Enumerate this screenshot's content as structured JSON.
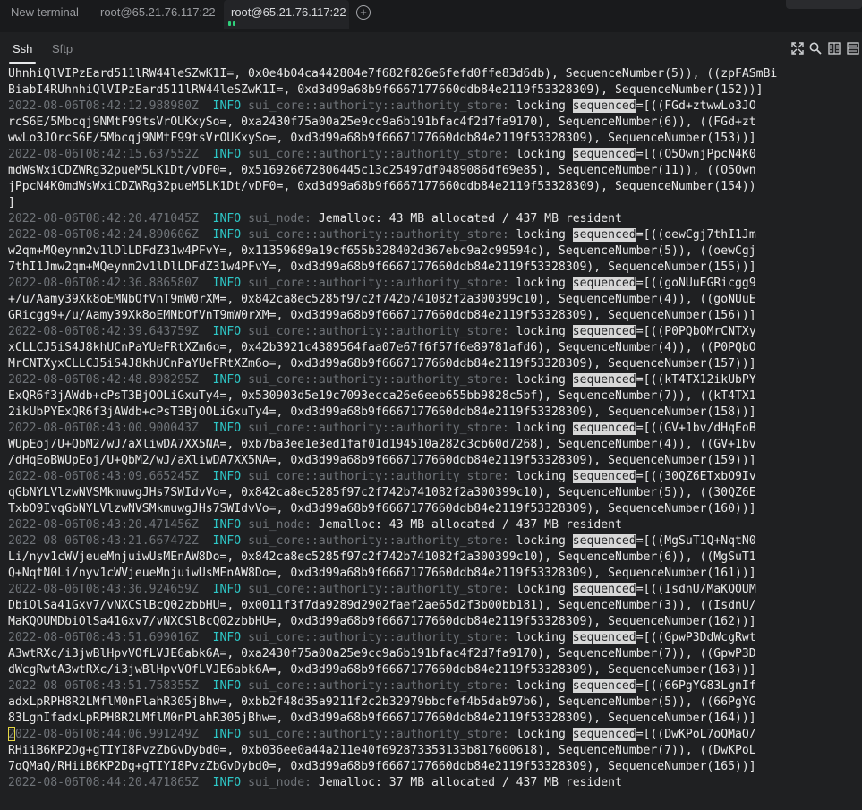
{
  "tabs": [
    {
      "label": "New terminal",
      "active": false
    },
    {
      "label": "root@65.21.76.117:22",
      "active": false
    },
    {
      "label": "root@65.21.76.117:22",
      "active": true
    }
  ],
  "subtabs": [
    {
      "label": "Ssh",
      "active": true
    },
    {
      "label": "Sftp",
      "active": false
    }
  ],
  "toolbar_icons": [
    "fullscreen-icon",
    "search-icon",
    "split-horizontal-icon",
    "split-vertical-icon"
  ],
  "colors": {
    "background": "#1f2022",
    "timestamp": "#6f7378",
    "info": "#2ec8c8",
    "text": "#e9e9e9",
    "highlight": "#d7d7d7",
    "cursor": "#e5d743",
    "status_dot": "#2fd07b"
  },
  "search_highlight": "sequenced",
  "terminal_lines": [
    {
      "text": "UhnhiQlVIPzEard511lRW44leSZwK1I=, 0x0e4b04ca442804e7f682f826e6fefd0ffe83d6db), SequenceNumber(5)), ((zpFASmBi"
    },
    {
      "text": "BiabI4RUhnhiQlVIPzEard511lRW44leSZwK1I=, 0xd3d99a68b9f6667177660ddb84e2119f53328309), SequenceNumber(152))]"
    },
    {
      "ts": "2022-08-06T08:42:12.988980Z",
      "level": "INFO",
      "module": "sui_core::authority::authority_store:",
      "msg": "locking",
      "hl": "sequenced",
      "rest": "=[((FGd+ztwwLo3JO"
    },
    {
      "text": "rcS6E/5Mbcqj9NMtF99tsVrOUKxySo=, 0xa2430f75a00a25e9cc9a6b191bfac4f2d7fa9170), SequenceNumber(6)), ((FGd+zt"
    },
    {
      "text": "wwLo3JOrcS6E/5Mbcqj9NMtF99tsVrOUKxySo=, 0xd3d99a68b9f6667177660ddb84e2119f53328309), SequenceNumber(153))]"
    },
    {
      "ts": "2022-08-06T08:42:15.637552Z",
      "level": "INFO",
      "module": "sui_core::authority::authority_store:",
      "msg": "locking",
      "hl": "sequenced",
      "rest": "=[((O5OwnjPpcN4K0"
    },
    {
      "text": "mdWsWxiCDZWRg32pueM5LK1Dt/vDF0=, 0x516926672806445c13c25497df0489086df69e85), SequenceNumber(11)), ((O5Own"
    },
    {
      "text": "jPpcN4K0mdWsWxiCDZWRg32pueM5LK1Dt/vDF0=, 0xd3d99a68b9f6667177660ddb84e2119f53328309), SequenceNumber(154))"
    },
    {
      "text": "]"
    },
    {
      "ts": "2022-08-06T08:42:20.471045Z",
      "level": "INFO",
      "module": "sui_node:",
      "msg": "Jemalloc: 43 MB allocated / 437 MB resident"
    },
    {
      "ts": "2022-08-06T08:42:24.890606Z",
      "level": "INFO",
      "module": "sui_core::authority::authority_store:",
      "msg": "locking",
      "hl": "sequenced",
      "rest": "=[((oewCgj7thI1Jm"
    },
    {
      "text": "w2qm+MQeynm2v1lDlLDFdZ31w4PFvY=, 0x11359689a19cf655b328402d367ebc9a2c99594c), SequenceNumber(5)), ((oewCgj"
    },
    {
      "text": "7thI1Jmw2qm+MQeynm2v1lDlLDFdZ31w4PFvY=, 0xd3d99a68b9f6667177660ddb84e2119f53328309), SequenceNumber(155))]"
    },
    {
      "ts": "2022-08-06T08:42:36.886580Z",
      "level": "INFO",
      "module": "sui_core::authority::authority_store:",
      "msg": "locking",
      "hl": "sequenced",
      "rest": "=[((goNUuEGRicgg9"
    },
    {
      "text": "+/u/Aamy39Xk8oEMNbOfVnT9mW0rXM=, 0x842ca8ec5285f97c2f742b741082f2a300399c10), SequenceNumber(4)), ((goNUuE"
    },
    {
      "text": "GRicgg9+/u/Aamy39Xk8oEMNbOfVnT9mW0rXM=, 0xd3d99a68b9f6667177660ddb84e2119f53328309), SequenceNumber(156))]"
    },
    {
      "ts": "2022-08-06T08:42:39.643759Z",
      "level": "INFO",
      "module": "sui_core::authority::authority_store:",
      "msg": "locking",
      "hl": "sequenced",
      "rest": "=[((P0PQbOMrCNTXy"
    },
    {
      "text": "xCLLCJ5iS4J8khUCnPaYUeFRtXZm6o=, 0x42b3921c4389564faa07e67f6f57f6e89781afd6), SequenceNumber(4)), ((P0PQbO"
    },
    {
      "text": "MrCNTXyxCLLCJ5iS4J8khUCnPaYUeFRtXZm6o=, 0xd3d99a68b9f6667177660ddb84e2119f53328309), SequenceNumber(157))]"
    },
    {
      "ts": "2022-08-06T08:42:48.898295Z",
      "level": "INFO",
      "module": "sui_core::authority::authority_store:",
      "msg": "locking",
      "hl": "sequenced",
      "rest": "=[((kT4TX12ikUbPY"
    },
    {
      "text": "ExQR6f3jAWdb+cPsT3BjOOLiGxuTy4=, 0x530903d5e19c7093ecca26e6eeb655bb9828c5bf), SequenceNumber(7)), ((kT4TX1"
    },
    {
      "text": "2ikUbPYExQR6f3jAWdb+cPsT3BjOOLiGxuTy4=, 0xd3d99a68b9f6667177660ddb84e2119f53328309), SequenceNumber(158))]"
    },
    {
      "ts": "2022-08-06T08:43:00.900043Z",
      "level": "INFO",
      "module": "sui_core::authority::authority_store:",
      "msg": "locking",
      "hl": "sequenced",
      "rest": "=[((GV+1bv/dHqEoB"
    },
    {
      "text": "WUpEoj/U+QbM2/wJ/aXliwDA7XX5NA=, 0xb7ba3ee1e3ed1faf01d194510a282c3cb60d7268), SequenceNumber(4)), ((GV+1bv"
    },
    {
      "text": "/dHqEoBWUpEoj/U+QbM2/wJ/aXliwDA7XX5NA=, 0xd3d99a68b9f6667177660ddb84e2119f53328309), SequenceNumber(159))]"
    },
    {
      "ts": "2022-08-06T08:43:09.665245Z",
      "level": "INFO",
      "module": "sui_core::authority::authority_store:",
      "msg": "locking",
      "hl": "sequenced",
      "rest": "=[((30QZ6ETxbO9Iv"
    },
    {
      "text": "qGbNYLVlzwNVSMkmuwgJHs7SWIdvVo=, 0x842ca8ec5285f97c2f742b741082f2a300399c10), SequenceNumber(5)), ((30QZ6E"
    },
    {
      "text": "TxbO9IvqGbNYLVlzwNVSMkmuwgJHs7SWIdvVo=, 0xd3d99a68b9f6667177660ddb84e2119f53328309), SequenceNumber(160))]"
    },
    {
      "ts": "2022-08-06T08:43:20.471456Z",
      "level": "INFO",
      "module": "sui_node:",
      "msg": "Jemalloc: 43 MB allocated / 437 MB resident"
    },
    {
      "ts": "2022-08-06T08:43:21.667472Z",
      "level": "INFO",
      "module": "sui_core::authority::authority_store:",
      "msg": "locking",
      "hl": "sequenced",
      "rest": "=[((MgSuT1Q+NqtN0"
    },
    {
      "text": "Li/nyv1cWVjeueMnjuiwUsMEnAW8Do=, 0x842ca8ec5285f97c2f742b741082f2a300399c10), SequenceNumber(6)), ((MgSuT1"
    },
    {
      "text": "Q+NqtN0Li/nyv1cWVjeueMnjuiwUsMEnAW8Do=, 0xd3d99a68b9f6667177660ddb84e2119f53328309), SequenceNumber(161))]"
    },
    {
      "ts": "2022-08-06T08:43:36.924659Z",
      "level": "INFO",
      "module": "sui_core::authority::authority_store:",
      "msg": "locking",
      "hl": "sequenced",
      "rest": "=[((IsdnU/MaKQOUM"
    },
    {
      "text": "DbiOlSa41Gxv7/vNXCSlBcQ02zbbHU=, 0x0011f3f7da9289d2902faef2ae65d2f3b00bb181), SequenceNumber(3)), ((IsdnU/"
    },
    {
      "text": "MaKQOUMDbiOlSa41Gxv7/vNXCSlBcQ02zbbHU=, 0xd3d99a68b9f6667177660ddb84e2119f53328309), SequenceNumber(162))]"
    },
    {
      "ts": "2022-08-06T08:43:51.699016Z",
      "level": "INFO",
      "module": "sui_core::authority::authority_store:",
      "msg": "locking",
      "hl": "sequenced",
      "rest": "=[((GpwP3DdWcgRwt"
    },
    {
      "text": "A3wtRXc/i3jwBlHpvVOfLVJE6abk6A=, 0xa2430f75a00a25e9cc9a6b191bfac4f2d7fa9170), SequenceNumber(7)), ((GpwP3D"
    },
    {
      "text": "dWcgRwtA3wtRXc/i3jwBlHpvVOfLVJE6abk6A=, 0xd3d99a68b9f6667177660ddb84e2119f53328309), SequenceNumber(163))]"
    },
    {
      "ts": "2022-08-06T08:43:51.758355Z",
      "level": "INFO",
      "module": "sui_core::authority::authority_store:",
      "msg": "locking",
      "hl": "sequenced",
      "rest": "=[((66PgYG83LgnIf"
    },
    {
      "text": "adxLpRPH8R2LMflM0nPlahR305jBhw=, 0xbb2f48d35a9211f2c2b32979bbcfef4b5dab97b6), SequenceNumber(5)), ((66PgYG"
    },
    {
      "text": "83LgnIfadxLpRPH8R2LMflM0nPlahR305jBhw=, 0xd3d99a68b9f6667177660ddb84e2119f53328309), SequenceNumber(164))]"
    },
    {
      "ts": "2022-08-06T08:44:06.991249Z",
      "level": "INFO",
      "module": "sui_core::authority::authority_store:",
      "msg": "locking",
      "hl": "sequenced",
      "rest": "=[((DwKPoL7oQMaQ/"
    },
    {
      "text": "RHiiB6KP2Dg+gTIYI8PvzZbGvDybd0=, 0xb036ee0a44a211e40f692873353133b817600618), SequenceNumber(7)), ((DwKPoL"
    },
    {
      "text": "7oQMaQ/RHiiB6KP2Dg+gTIYI8PvzZbGvDybd0=, 0xd3d99a68b9f6667177660ddb84e2119f53328309), SequenceNumber(165))]"
    },
    {
      "ts": "2022-08-06T08:44:20.471865Z",
      "level": "INFO",
      "module": "sui_node:",
      "msg": "Jemalloc: 37 MB allocated / 437 MB resident"
    }
  ]
}
